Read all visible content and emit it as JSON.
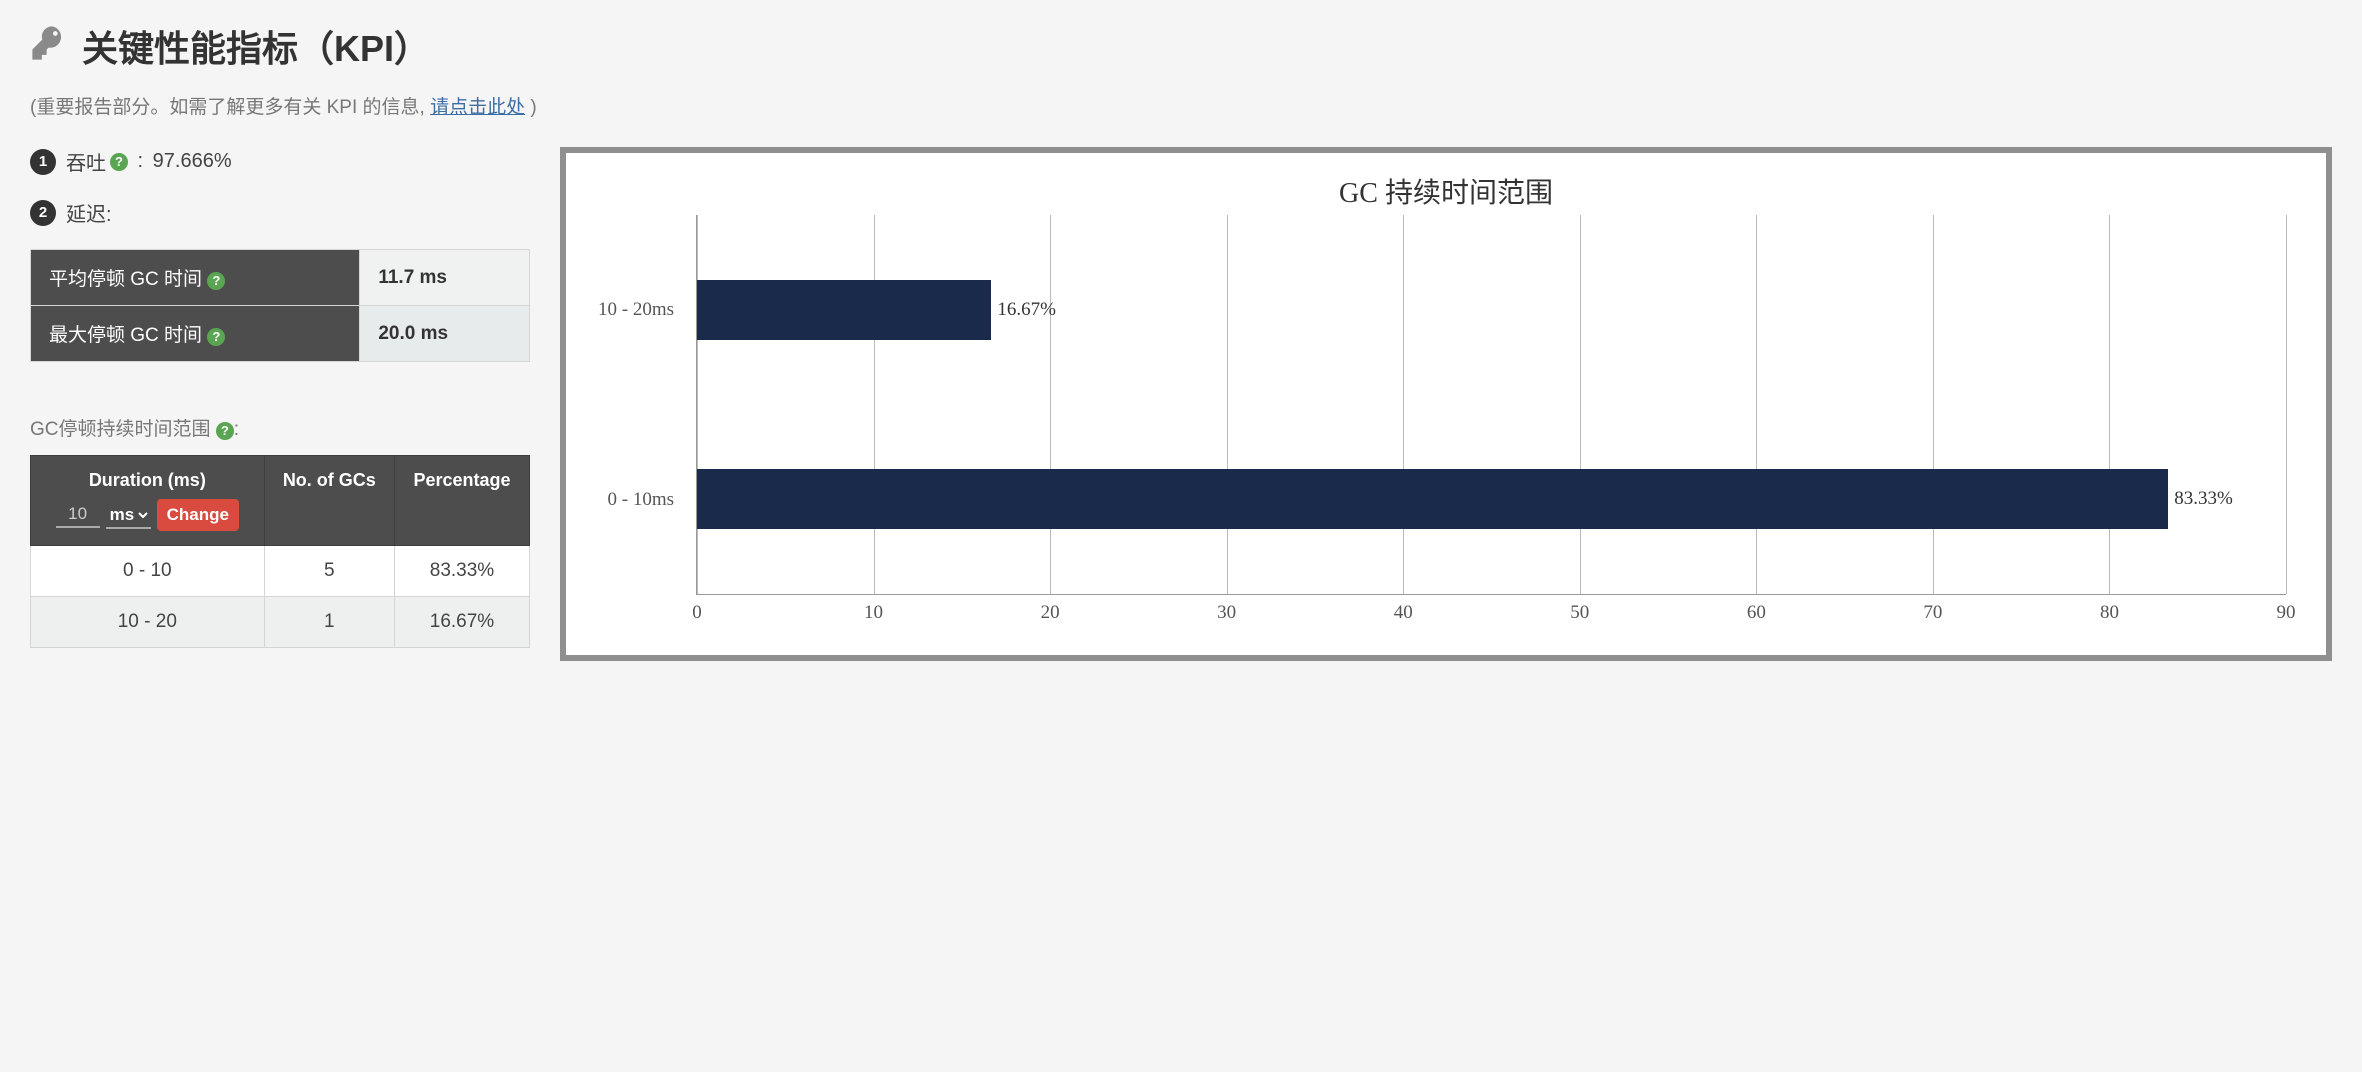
{
  "header": {
    "title": "关键性能指标（KPI）"
  },
  "subtitle": {
    "prefix": "(重要报告部分。如需了解更多有关 KPI 的信息, ",
    "link": "请点击此处",
    "suffix": ")"
  },
  "kpi": {
    "throughput_label": "吞吐",
    "throughput_value": "97.666%",
    "latency_label": "延迟:",
    "rows": [
      {
        "label": "平均停顿 GC 时间",
        "value": "11.7 ms"
      },
      {
        "label": "最大停顿 GC 时间",
        "value": "20.0 ms"
      }
    ]
  },
  "duration_section": {
    "label": "GC停顿持续时间范围",
    "columns": [
      "Duration (ms)",
      "No. of GCs",
      "Percentage"
    ],
    "input_value": "10",
    "unit_selected": "ms",
    "change_label": "Change",
    "rows": [
      {
        "range": "0 - 10",
        "count": "5",
        "pct": "83.33%"
      },
      {
        "range": "10 - 20",
        "count": "1",
        "pct": "16.67%"
      }
    ]
  },
  "chart_data": {
    "type": "bar",
    "orientation": "horizontal",
    "title": "GC 持续时间范围",
    "xlabel": "",
    "ylabel": "",
    "categories": [
      "10 - 20ms",
      "0 - 10ms"
    ],
    "values": [
      16.67,
      83.33
    ],
    "value_labels": [
      "16.67%",
      "83.33%"
    ],
    "xlim": [
      0,
      90
    ],
    "xticks": [
      0,
      10,
      20,
      30,
      40,
      50,
      60,
      70,
      80,
      90
    ]
  }
}
